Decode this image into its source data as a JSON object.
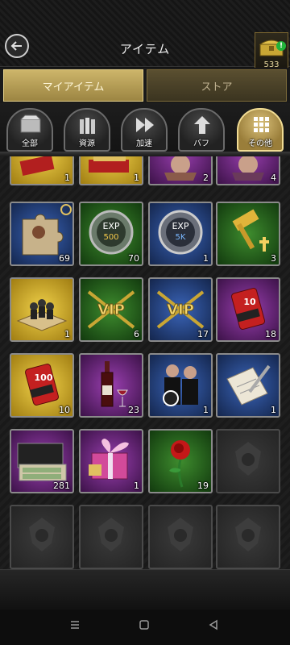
{
  "header": {
    "title": "アイテム",
    "chest_count": "533",
    "alert": "!"
  },
  "tabs": {
    "my_items": "マイアイテム",
    "store": "ストア"
  },
  "categories": [
    {
      "label": "全部",
      "icon": "box-icon"
    },
    {
      "label": "資源",
      "icon": "bullets-icon"
    },
    {
      "label": "加速",
      "icon": "fast-forward-icon"
    },
    {
      "label": "バフ",
      "icon": "buff-arrow-icon"
    },
    {
      "label": "その他",
      "icon": "grid-icon"
    }
  ],
  "items": [
    {
      "icon": "ticket-icon",
      "qty": "1"
    },
    {
      "icon": "ticket-bundle-icon",
      "qty": "1"
    },
    {
      "icon": "portrait-piece-icon",
      "qty": "2"
    },
    {
      "icon": "portrait-piece-icon",
      "qty": "4"
    },
    {
      "icon": "puzzle-piece-icon",
      "qty": "69"
    },
    {
      "icon": "exp-500-badge-icon",
      "qty": "70",
      "badge": "500",
      "badge_title": "EXP"
    },
    {
      "icon": "exp-5k-badge-icon",
      "qty": "1",
      "badge": "5K",
      "badge_title": "EXP"
    },
    {
      "icon": "golden-hammer-icon",
      "qty": "3"
    },
    {
      "icon": "map-figures-icon",
      "qty": "1"
    },
    {
      "icon": "vip-badge-icon",
      "qty": "6",
      "badge": "VIP"
    },
    {
      "icon": "vip-badge-icon",
      "qty": "17",
      "badge": "VIP"
    },
    {
      "icon": "exp-can-icon",
      "qty": "18",
      "badge": "10"
    },
    {
      "icon": "exp-can-icon",
      "qty": "10",
      "badge": "100"
    },
    {
      "icon": "wine-bottle-icon",
      "qty": "23"
    },
    {
      "icon": "agents-swap-icon",
      "qty": "1"
    },
    {
      "icon": "document-pen-icon",
      "qty": "1"
    },
    {
      "icon": "cash-briefcase-icon",
      "qty": "281"
    },
    {
      "icon": "gift-box-icon",
      "qty": "1"
    },
    {
      "icon": "red-rose-icon",
      "qty": "19"
    },
    {
      "icon": "empty-slot-icon",
      "qty": ""
    },
    {
      "icon": "empty-slot-icon",
      "qty": ""
    },
    {
      "icon": "empty-slot-icon",
      "qty": ""
    },
    {
      "icon": "empty-slot-icon",
      "qty": ""
    },
    {
      "icon": "empty-slot-icon",
      "qty": ""
    }
  ]
}
